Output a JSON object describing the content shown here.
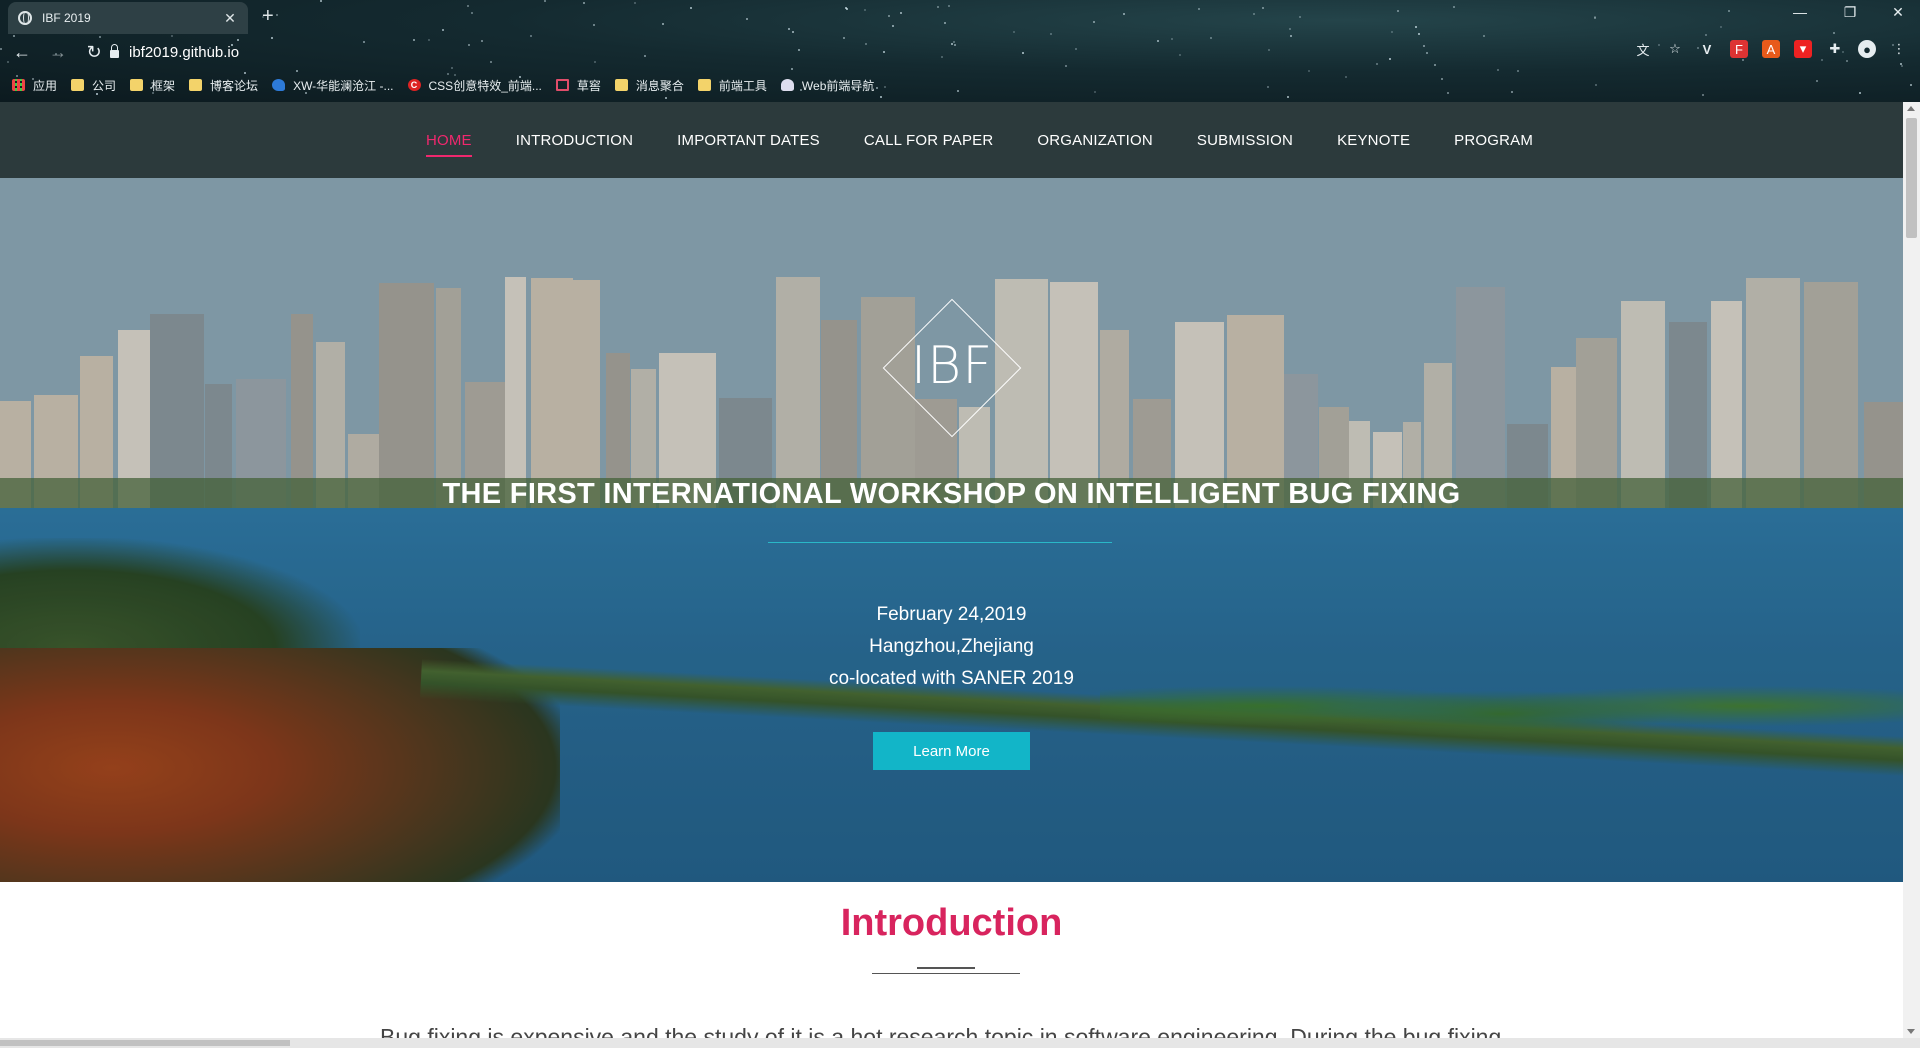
{
  "browser": {
    "tab_title": "IBF 2019",
    "url": "ibf2019.github.io",
    "bookmarks": [
      {
        "label": "应用",
        "icon": "apps-grid-icon"
      },
      {
        "label": "公司",
        "icon": "folder-icon"
      },
      {
        "label": "框架",
        "icon": "folder-icon"
      },
      {
        "label": "博客论坛",
        "icon": "folder-icon"
      },
      {
        "label": "XW-华能澜沧江 -...",
        "icon": "bird-icon"
      },
      {
        "label": "CSS创意特效_前端...",
        "icon": "c-logo-icon"
      },
      {
        "label": "草窖",
        "icon": "mail-icon"
      },
      {
        "label": "消息聚合",
        "icon": "folder-icon"
      },
      {
        "label": "前端工具",
        "icon": "folder-icon"
      },
      {
        "label": "Web前端导航",
        "icon": "bell-icon"
      }
    ]
  },
  "nav": {
    "items": [
      "HOME",
      "INTRODUCTION",
      "IMPORTANT DATES",
      "CALL FOR PAPER",
      "ORGANIZATION",
      "SUBMISSION",
      "KEYNOTE",
      "PROGRAM"
    ],
    "active": "HOME"
  },
  "hero": {
    "logo": "IBF",
    "title": "THE FIRST INTERNATIONAL WORKSHOP ON INTELLIGENT BUG FIXING",
    "date": "February 24,2019",
    "location": "Hangzhou,Zhejiang",
    "colocated": "co-located with SANER 2019",
    "button": "Learn More"
  },
  "intro": {
    "title": "Introduction",
    "text": "Bug fixing is expensive and the study of it is a hot research topic in software engineering. During the bug fixing"
  },
  "colors": {
    "nav_bg": "#2c3a3c",
    "accent_pink": "#f0286e",
    "button_cyan": "#12b5c8",
    "intro_title": "#d8245e"
  }
}
